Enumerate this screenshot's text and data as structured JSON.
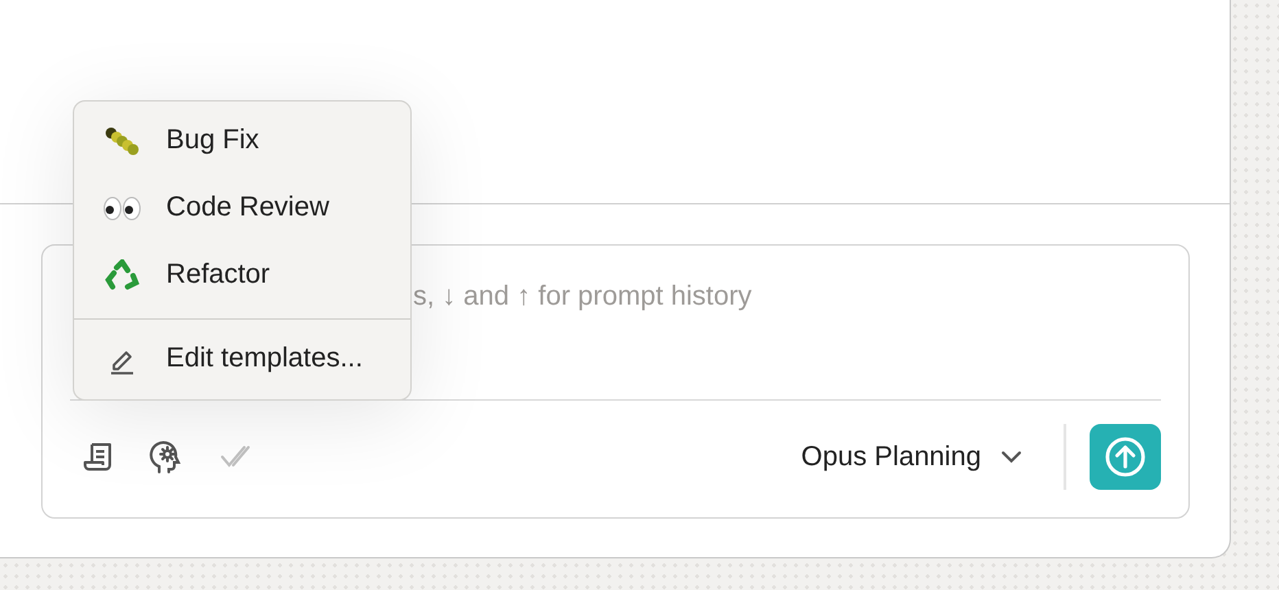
{
  "composer": {
    "placeholder": "s, ↓ and ↑ for prompt history",
    "toolbar": [
      {
        "disabled": false
      },
      {
        "disabled": false
      },
      {
        "disabled": true
      }
    ],
    "model": "Opus Planning"
  },
  "menu": {
    "templates": [
      {
        "label": "Bug Fix"
      },
      {
        "label": "Code Review"
      },
      {
        "label": "Refactor"
      }
    ],
    "actions": [
      {
        "label": "Edit templates..."
      }
    ]
  }
}
